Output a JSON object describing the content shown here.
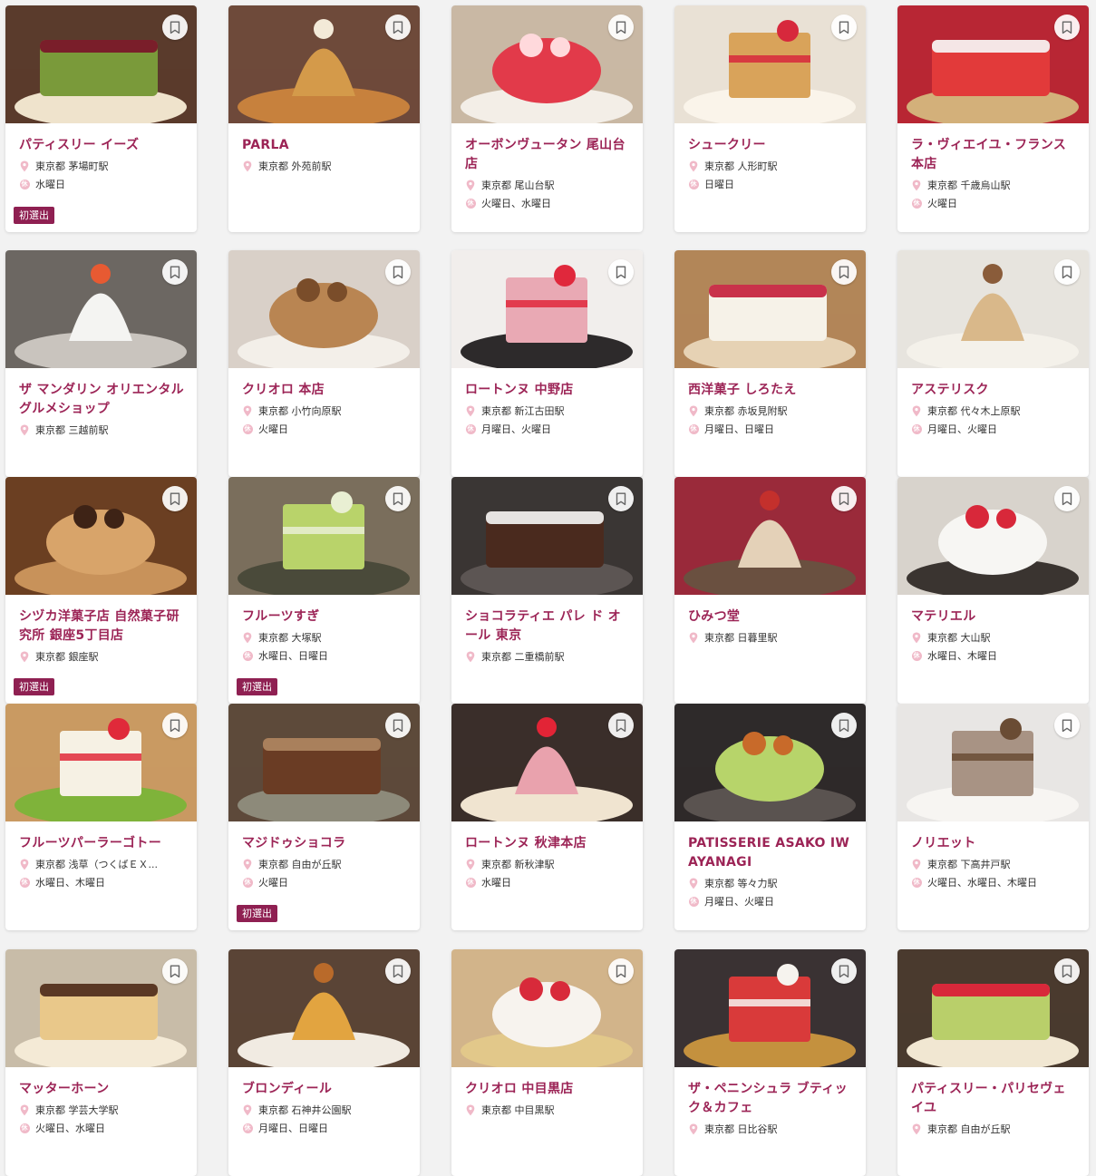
{
  "colors": {
    "accent": "#9c2456",
    "badge": "#8f2052",
    "icon": "#f0b9c8"
  },
  "labels": {
    "new_badge": "初選出",
    "closed_icon": "休"
  },
  "shops": [
    {
      "name": "パティスリー イーズ",
      "location": "東京都 茅場町駅",
      "closed": "水曜日",
      "badge": true,
      "photo": {
        "bg": "#5a3b2c",
        "main": "#7a9a3a",
        "accent": "#7a1e2a",
        "plate": "#efe3cc"
      }
    },
    {
      "name": "PARLA",
      "location": "東京都 外苑前駅",
      "closed": "",
      "badge": false,
      "photo": {
        "bg": "#6e4a3a",
        "main": "#d49a4a",
        "accent": "#f3ead8",
        "plate": "#c7813d"
      }
    },
    {
      "name": "オーボンヴュータン 尾山台店",
      "location": "東京都 尾山台駅",
      "closed": "火曜日、水曜日",
      "badge": false,
      "photo": {
        "bg": "#c9b8a4",
        "main": "#e23a4a",
        "accent": "#ffd9dc",
        "plate": "#f3eee7"
      }
    },
    {
      "name": "シュークリー",
      "location": "東京都 人形町駅",
      "closed": "日曜日",
      "badge": false,
      "photo": {
        "bg": "#e9e1d5",
        "main": "#d9a35a",
        "accent": "#d7283c",
        "plate": "#faf4ea"
      }
    },
    {
      "name": "ラ・ヴィエイユ・フランス 本店",
      "location": "東京都 千歳烏山駅",
      "closed": "火曜日",
      "badge": false,
      "photo": {
        "bg": "#b82634",
        "main": "#e23a3a",
        "accent": "#f5e6e6",
        "plate": "#d3b07a"
      }
    },
    {
      "name": "ザ マンダリン オリエンタル グルメショップ",
      "location": "東京都 三越前駅",
      "closed": "",
      "badge": false,
      "photo": {
        "bg": "#6c6762",
        "main": "#f4f4f2",
        "accent": "#e75a32",
        "plate": "#c9c4be"
      }
    },
    {
      "name": "クリオロ 本店",
      "location": "東京都 小竹向原駅",
      "closed": "火曜日",
      "badge": false,
      "photo": {
        "bg": "#d9d0c8",
        "main": "#b98552",
        "accent": "#7a4d2a",
        "plate": "#f3efe9"
      }
    },
    {
      "name": "ロートンヌ 中野店",
      "location": "東京都 新江古田駅",
      "closed": "月曜日、火曜日",
      "badge": false,
      "photo": {
        "bg": "#f1eeec",
        "main": "#e9a9b4",
        "accent": "#e0283c",
        "plate": "#2d2a2b"
      }
    },
    {
      "name": "西洋菓子 しろたえ",
      "location": "東京都 赤坂見附駅",
      "closed": "月曜日、日曜日",
      "badge": false,
      "photo": {
        "bg": "#b28658",
        "main": "#f6f2e8",
        "accent": "#c9324a",
        "plate": "#e6d2b4"
      }
    },
    {
      "name": "アステリスク",
      "location": "東京都 代々木上原駅",
      "closed": "月曜日、火曜日",
      "badge": false,
      "photo": {
        "bg": "#e7e4de",
        "main": "#d9b88a",
        "accent": "#8a5c3a",
        "plate": "#f4f1ea"
      }
    },
    {
      "name": "シヅカ洋菓子店 自然菓子研究所 銀座5丁目店",
      "location": "東京都 銀座駅",
      "closed": "",
      "badge": true,
      "photo": {
        "bg": "#6b3f22",
        "main": "#d8a46a",
        "accent": "#3e2316",
        "plate": "#c8925a"
      }
    },
    {
      "name": "フルーツすぎ",
      "location": "東京都 大塚駅",
      "closed": "水曜日、日曜日",
      "badge": true,
      "photo": {
        "bg": "#7a6e5c",
        "main": "#b9d36a",
        "accent": "#e9efd3",
        "plate": "#4a4a3a"
      }
    },
    {
      "name": "ショコラティエ パレ ド オール 東京",
      "location": "東京都 二重橋前駅",
      "closed": "",
      "badge": false,
      "photo": {
        "bg": "#3a3634",
        "main": "#4a2a1e",
        "accent": "#e6e3e1",
        "plate": "#5c5553"
      }
    },
    {
      "name": "ひみつ堂",
      "location": "東京都 日暮里駅",
      "closed": "",
      "badge": false,
      "photo": {
        "bg": "#9a2a3a",
        "main": "#e4d1b8",
        "accent": "#c4302c",
        "plate": "#6a5040"
      }
    },
    {
      "name": "マテリエル",
      "location": "東京都 大山駅",
      "closed": "水曜日、木曜日",
      "badge": false,
      "photo": {
        "bg": "#d8d3cc",
        "main": "#f7f6f3",
        "accent": "#d8283a",
        "plate": "#3a3430"
      }
    },
    {
      "name": "フルーツパーラーゴトー",
      "location": "東京都 浅草（つくばＥＸ...",
      "closed": "水曜日、木曜日",
      "badge": false,
      "photo": {
        "bg": "#c99a62",
        "main": "#f6f1e4",
        "accent": "#e02a3a",
        "plate": "#7fb33a"
      }
    },
    {
      "name": "マジドゥショコラ",
      "location": "東京都 自由が丘駅",
      "closed": "火曜日",
      "badge": true,
      "photo": {
        "bg": "#5d4a3a",
        "main": "#6a3c24",
        "accent": "#a9805c",
        "plate": "#8d8a7a"
      }
    },
    {
      "name": "ロートンヌ 秋津本店",
      "location": "東京都 新秋津駅",
      "closed": "水曜日",
      "badge": false,
      "photo": {
        "bg": "#3a2e2a",
        "main": "#e9a2ad",
        "accent": "#e22436",
        "plate": "#f0e4d0"
      }
    },
    {
      "name": "PATISSERIE ASAKO IWAYANAGI",
      "location": "東京都 等々力駅",
      "closed": "月曜日、火曜日",
      "badge": false,
      "photo": {
        "bg": "#2e2a2a",
        "main": "#b7d46a",
        "accent": "#c86a2a",
        "plate": "#5a5350"
      }
    },
    {
      "name": "ノリエット",
      "location": "東京都 下高井戸駅",
      "closed": "火曜日、水曜日、木曜日",
      "badge": false,
      "photo": {
        "bg": "#e8e6e4",
        "main": "#a89384",
        "accent": "#6a4c34",
        "plate": "#f7f5f2"
      }
    },
    {
      "name": "マッターホーン",
      "location": "東京都 学芸大学駅",
      "closed": "火曜日、水曜日",
      "badge": false,
      "photo": {
        "bg": "#c8bca8",
        "main": "#e9c88a",
        "accent": "#5a3824",
        "plate": "#f4ead6"
      }
    },
    {
      "name": "ブロンディール",
      "location": "東京都 石神井公園駅",
      "closed": "月曜日、日曜日",
      "badge": false,
      "photo": {
        "bg": "#5a4436",
        "main": "#e2a440",
        "accent": "#b96a2a",
        "plate": "#f1ebe2"
      }
    },
    {
      "name": "クリオロ 中目黒店",
      "location": "東京都 中目黒駅",
      "closed": "",
      "badge": false,
      "photo": {
        "bg": "#d2b48a",
        "main": "#f7f3ee",
        "accent": "#d82a3a",
        "plate": "#e2c88a"
      }
    },
    {
      "name": "ザ・ペニンシュラ ブティック＆カフェ",
      "location": "東京都 日比谷駅",
      "closed": "",
      "badge": false,
      "photo": {
        "bg": "#3a3233",
        "main": "#d93a3a",
        "accent": "#f6f3ee",
        "plate": "#c4913e"
      }
    },
    {
      "name": "パティスリー・パリセヴェイユ",
      "location": "東京都 自由が丘駅",
      "closed": "",
      "badge": false,
      "photo": {
        "bg": "#4a3a2e",
        "main": "#b9cf6a",
        "accent": "#d8283a",
        "plate": "#f1e7d2"
      }
    }
  ]
}
